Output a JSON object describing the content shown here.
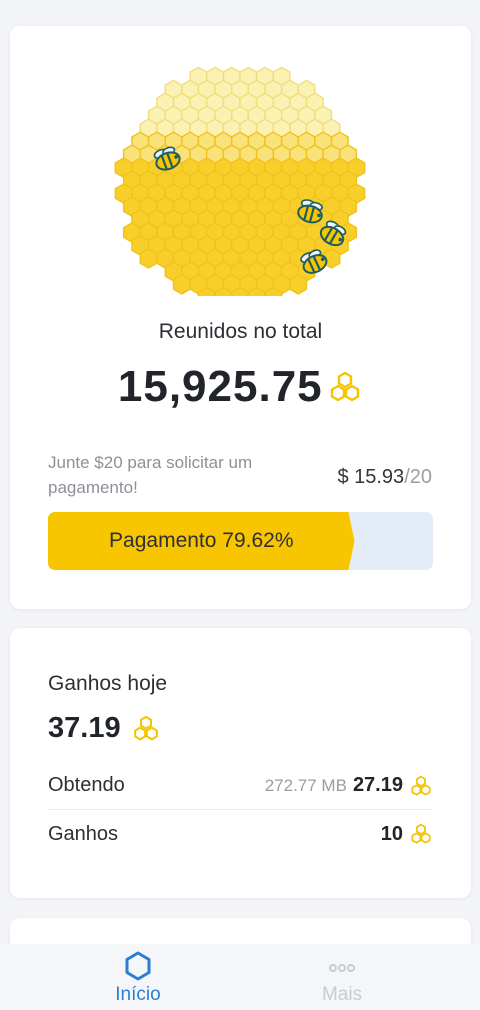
{
  "summary": {
    "total_label": "Reunidos no total",
    "total_value": "15,925.75",
    "hint": "Junte $20 para solicitar um pagamento!",
    "goal_current": "$ 15.93",
    "goal_target": "/20",
    "progress_label": "Pagamento 79.62%",
    "progress_fraction": 0.7962
  },
  "today": {
    "title": "Ganhos hoje",
    "value": "37.19",
    "rows": [
      {
        "label": "Obtendo",
        "sub": "272.77 MB",
        "value": "27.19"
      },
      {
        "label": "Ganhos",
        "sub": "",
        "value": "10"
      }
    ]
  },
  "nav": {
    "home_label": "Início",
    "more_label": "Mais"
  },
  "icons": {
    "currency": "honeycomb-icon",
    "hive": "beehive-illustration",
    "home": "hexagon-icon",
    "more": "dots-icon"
  },
  "colors": {
    "accent_yellow": "#f7c600",
    "progress_track": "#e4edf7",
    "nav_active": "#2a7fd4"
  }
}
